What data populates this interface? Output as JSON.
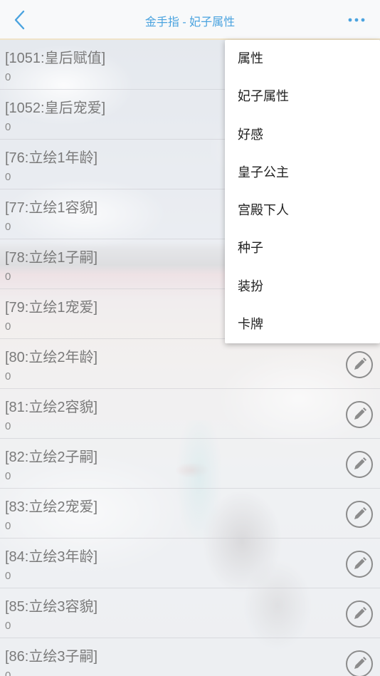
{
  "header": {
    "title": "金手指 - 妃子属性",
    "back_icon": "chevron-left-icon",
    "more_icon": "more-horizontal-icon",
    "accent": "#4aa3df"
  },
  "list": {
    "items": [
      {
        "label": "[1051:皇后赋值]",
        "value": "0"
      },
      {
        "label": "[1052:皇后宠爱]",
        "value": "0"
      },
      {
        "label": "[76:立绘1年龄]",
        "value": "0"
      },
      {
        "label": "[77:立绘1容貌]",
        "value": "0"
      },
      {
        "label": "[78:立绘1子嗣]",
        "value": "0"
      },
      {
        "label": "[79:立绘1宠爱]",
        "value": "0"
      },
      {
        "label": "[80:立绘2年龄]",
        "value": "0"
      },
      {
        "label": "[81:立绘2容貌]",
        "value": "0"
      },
      {
        "label": "[82:立绘2子嗣]",
        "value": "0"
      },
      {
        "label": "[83:立绘2宠爱]",
        "value": "0"
      },
      {
        "label": "[84:立绘3年龄]",
        "value": "0"
      },
      {
        "label": "[85:立绘3容貌]",
        "value": "0"
      },
      {
        "label": "[86:立绘3子嗣]",
        "value": "0"
      }
    ],
    "edit_icon": "pencil-icon"
  },
  "menu": {
    "items": [
      {
        "label": "属性"
      },
      {
        "label": "妃子属性"
      },
      {
        "label": "好感"
      },
      {
        "label": "皇子公主"
      },
      {
        "label": "宫殿下人"
      },
      {
        "label": "种子"
      },
      {
        "label": "装扮"
      },
      {
        "label": "卡牌"
      }
    ]
  }
}
